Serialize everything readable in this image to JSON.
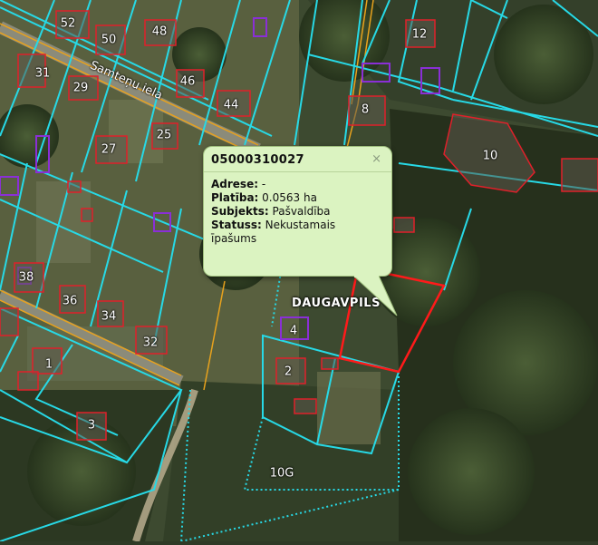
{
  "map": {
    "street_name": "Samteņu iela",
    "city_label": "DAUGAVPILS",
    "parcel_numbers": [
      {
        "label": "52"
      },
      {
        "label": "50"
      },
      {
        "label": "48"
      },
      {
        "label": "31"
      },
      {
        "label": "29"
      },
      {
        "label": "46"
      },
      {
        "label": "44"
      },
      {
        "label": "27"
      },
      {
        "label": "25"
      },
      {
        "label": "12"
      },
      {
        "label": "8"
      },
      {
        "label": "10"
      },
      {
        "label": "38"
      },
      {
        "label": "36"
      },
      {
        "label": "34"
      },
      {
        "label": "32"
      },
      {
        "label": "1"
      },
      {
        "label": "4"
      },
      {
        "label": "2"
      },
      {
        "label": "3"
      },
      {
        "label": "10G"
      }
    ],
    "colors": {
      "parcel_border": "#27d9e6",
      "building_outline": "#e0202a",
      "selected_parcel": "#ff1a1a",
      "road_line": "#e8a21d",
      "purple_outline": "#8a2fd6"
    }
  },
  "popup": {
    "title": "05000310027",
    "close_label": "×",
    "fields": [
      {
        "name": "Adrese:",
        "value": "-"
      },
      {
        "name": "Platība:",
        "value": "0.0563 ha"
      },
      {
        "name": "Subjekts:",
        "value": "Pašvaldība"
      },
      {
        "name": "Statuss:",
        "value": "Nekustamais īpašums"
      }
    ]
  }
}
